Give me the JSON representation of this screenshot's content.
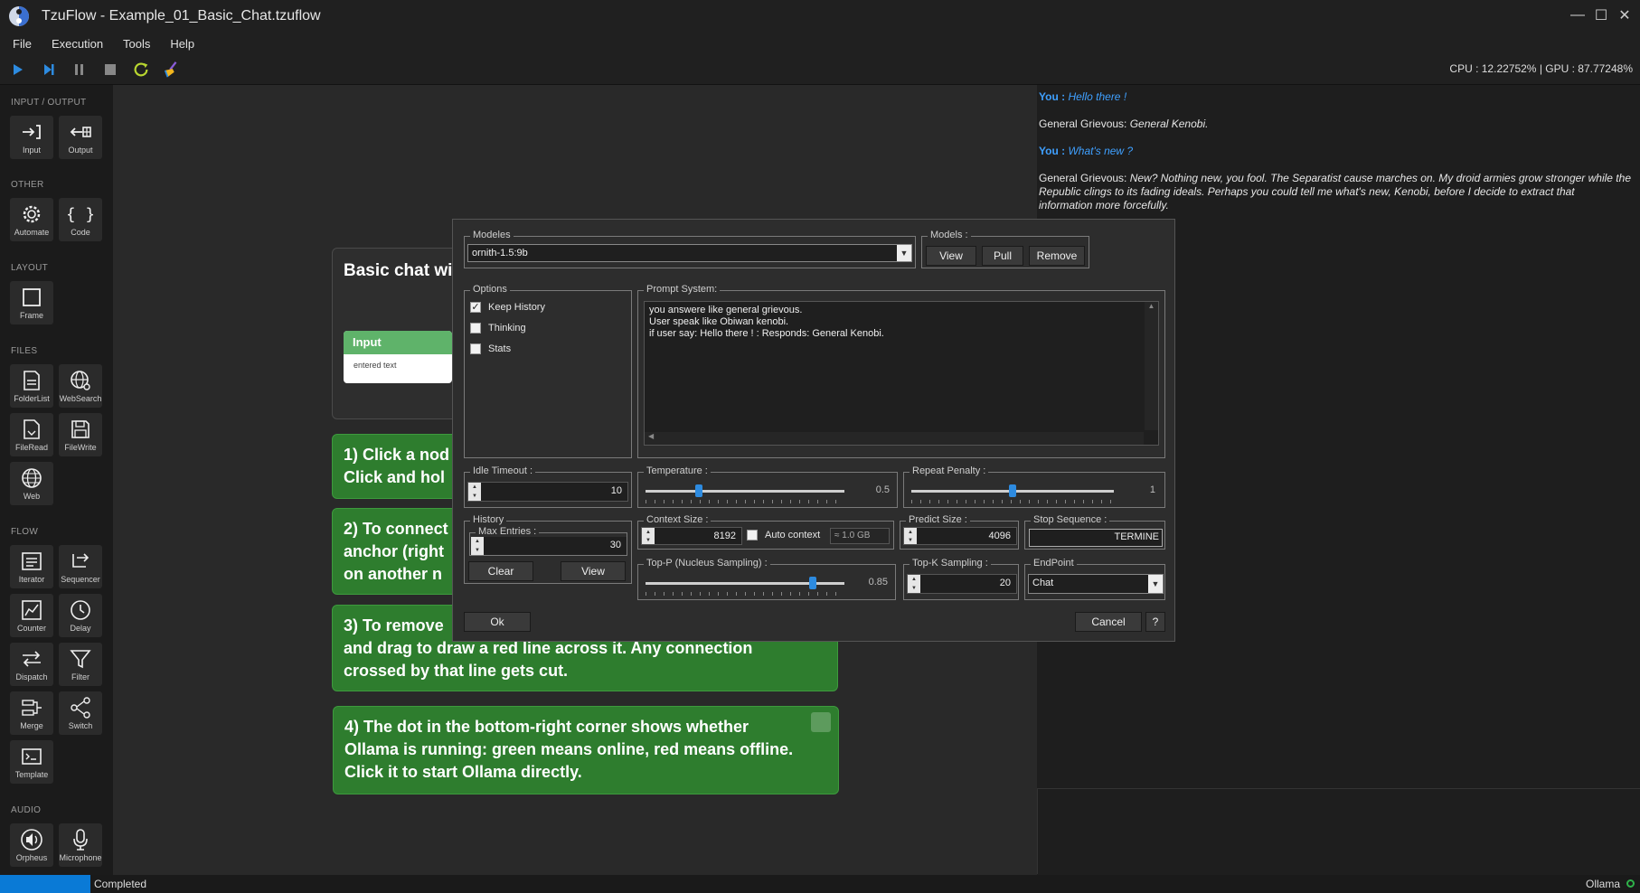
{
  "window": {
    "title": "TzuFlow - Example_01_Basic_Chat.tzuflow",
    "controls": [
      "minimize-icon",
      "maximize-icon",
      "close-icon"
    ]
  },
  "menu": [
    "File",
    "Execution",
    "Tools",
    "Help"
  ],
  "toolbar": {
    "buttons": [
      "play-icon",
      "step-icon",
      "pause-icon",
      "stop-icon",
      "refresh-icon",
      "clean-icon"
    ],
    "perf": "CPU : 12.22752% | GPU : 87.77248%"
  },
  "sidebar": {
    "sections": [
      {
        "title": "INPUT / OUTPUT",
        "tools": [
          {
            "label": "Input",
            "icon": "input-icon"
          },
          {
            "label": "Output",
            "icon": "output-icon"
          }
        ]
      },
      {
        "title": "OTHER",
        "tools": [
          {
            "label": "Automate",
            "icon": "gear-icon"
          },
          {
            "label": "Code",
            "icon": "braces-icon"
          }
        ]
      },
      {
        "title": "LAYOUT",
        "tools": [
          {
            "label": "Frame",
            "icon": "frame-icon"
          }
        ]
      },
      {
        "title": "FILES",
        "tools": [
          {
            "label": "FolderList",
            "icon": "folder-list-icon"
          },
          {
            "label": "WebSearch",
            "icon": "web-search-icon"
          },
          {
            "label": "FileRead",
            "icon": "file-read-icon"
          },
          {
            "label": "FileWrite",
            "icon": "save-icon"
          },
          {
            "label": "Web",
            "icon": "globe-icon"
          }
        ]
      },
      {
        "title": "FLOW",
        "tools": [
          {
            "label": "Iterator",
            "icon": "iterator-icon"
          },
          {
            "label": "Sequencer",
            "icon": "sequencer-icon"
          },
          {
            "label": "Counter",
            "icon": "counter-icon"
          },
          {
            "label": "Delay",
            "icon": "clock-icon"
          },
          {
            "label": "Dispatch",
            "icon": "dispatch-icon"
          },
          {
            "label": "Filter",
            "icon": "filter-icon"
          },
          {
            "label": "Merge",
            "icon": "merge-icon"
          },
          {
            "label": "Switch",
            "icon": "switch-icon"
          },
          {
            "label": "Template",
            "icon": "template-icon"
          }
        ]
      },
      {
        "title": "AUDIO",
        "tools": [
          {
            "label": "Orpheus",
            "icon": "speaker-icon"
          },
          {
            "label": "Microphone",
            "icon": "microphone-icon"
          }
        ]
      }
    ]
  },
  "canvas": {
    "group_title": "Basic chat wit",
    "input_node": {
      "title": "Input",
      "body": "entered text"
    },
    "notes": [
      {
        "lines": [
          "1) Click a nod",
          "Click and hol"
        ]
      },
      {
        "lines": [
          "2) To connect",
          "anchor (right",
          "on another n"
        ]
      },
      {
        "lines": [
          "3) To remove",
          "and drag to draw a red line across it. Any connection",
          "crossed by that line gets cut."
        ]
      },
      {
        "lines": [
          "4) The dot in the bottom-right corner shows whether",
          "Ollama is running: green means online, red means offline.",
          "Click it to start Ollama directly."
        ]
      }
    ]
  },
  "chat": {
    "messages": [
      {
        "role": "You",
        "sep": " : ",
        "text": "Hello there !"
      },
      {
        "role": "General Grievous",
        "sep": ": ",
        "text": "General Kenobi."
      },
      {
        "role": "You",
        "sep": " : ",
        "text": "What's new ?"
      },
      {
        "role": "General Grievous",
        "sep": ": ",
        "text": "New? Nothing new, you fool. The Separatist cause marches on. My droid armies grow stronger while the Republic clings to its fading ideals. Perhaps you could tell me what's new, Kenobi, before I decide to extract that information more forcefully."
      }
    ]
  },
  "status": {
    "text": "Completed",
    "ollama": "Ollama",
    "ollama_color": "#2fb24a"
  },
  "dialog": {
    "modeles_legend": "Modeles",
    "model_selected": "ornith-1.5:9b",
    "models_legend": "Models :",
    "models_buttons": {
      "view": "View",
      "pull": "Pull",
      "remove": "Remove"
    },
    "options_legend": "Options",
    "options": [
      {
        "label": "Keep History",
        "checked": true,
        "mark": "✓"
      },
      {
        "label": "Thinking",
        "checked": false,
        "mark": ""
      },
      {
        "label": "Stats",
        "checked": false,
        "mark": ""
      }
    ],
    "prompt_legend": "Prompt System:",
    "prompt_text": "you answere like general grievous.\nUser speak like Obiwan kenobi.\nif user say: Hello there ! : Responds: General Kenobi.",
    "idle_legend": "Idle Timeout :",
    "idle_value": "10",
    "temperature_legend": "Temperature :",
    "temperature_value": "0.5",
    "temperature_fraction": 0.27,
    "repeat_legend": "Repeat Penalty :",
    "repeat_value": "1",
    "repeat_fraction": 0.5,
    "history_legend": "History",
    "max_entries_legend": "Max Entries :",
    "max_entries_value": "30",
    "history_buttons": {
      "clear": "Clear",
      "view": "View"
    },
    "context_legend": "Context Size :",
    "context_value": "8192",
    "auto_context_label": "Auto context",
    "context_estimate": "≈ 1.0 GB",
    "predict_legend": "Predict Size :",
    "predict_value": "4096",
    "stop_legend": "Stop Sequence :",
    "stop_value": "TERMINE",
    "topp_legend": "Top-P (Nucleus Sampling) :",
    "topp_value": "0.85",
    "topp_fraction": 0.84,
    "topk_legend": "Top-K Sampling :",
    "topk_value": "20",
    "endpoint_legend": "EndPoint",
    "endpoint_value": "Chat",
    "ok": "Ok",
    "cancel": "Cancel",
    "help": "?"
  }
}
